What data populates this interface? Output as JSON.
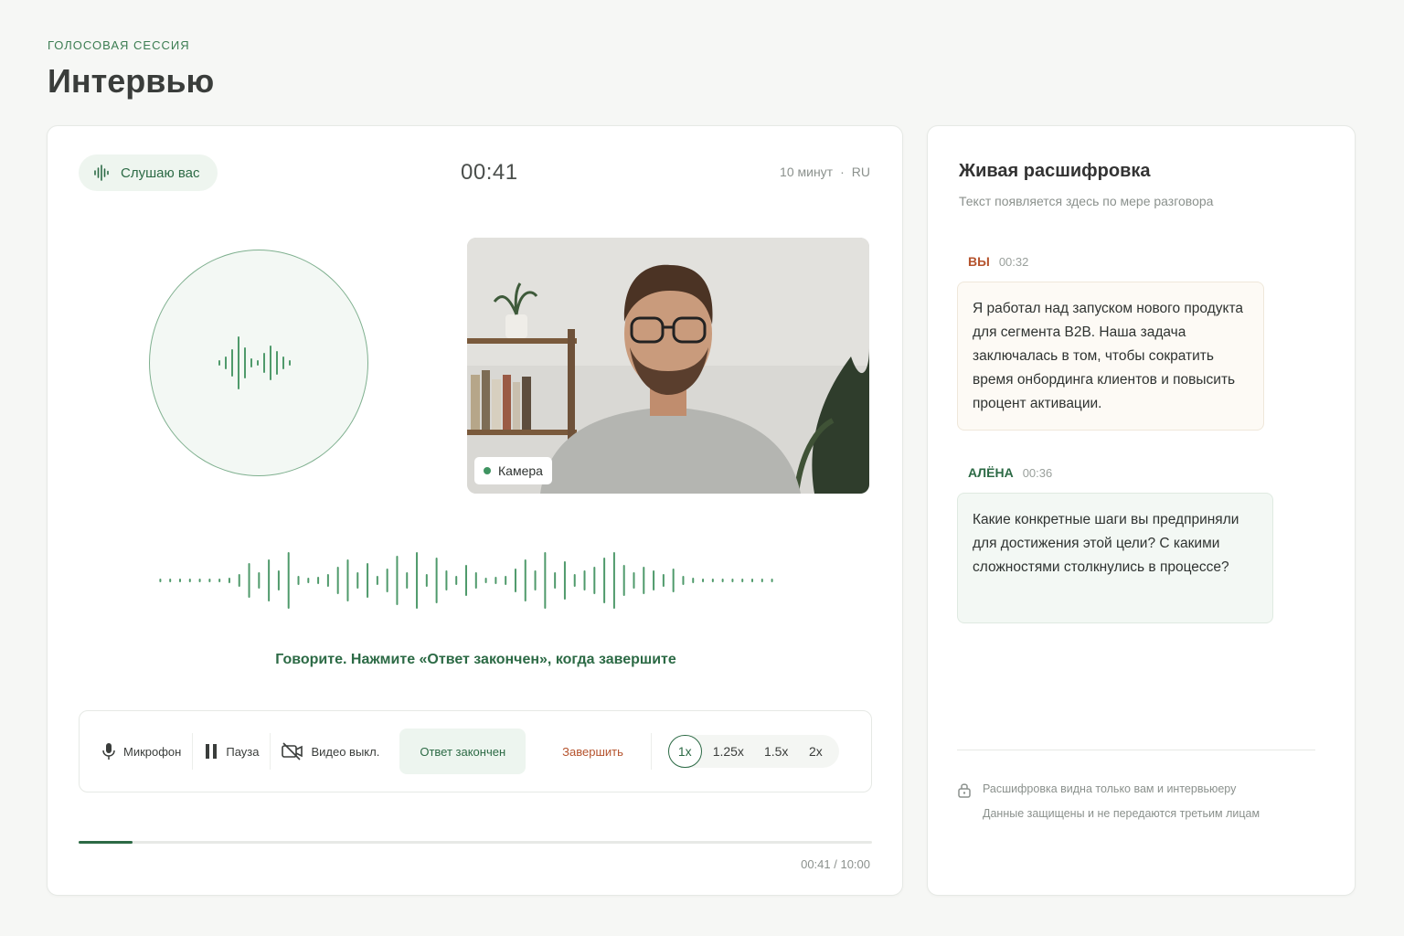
{
  "header": {
    "eyebrow": "ГОЛОСОВАЯ СЕССИЯ",
    "title": "Интервью"
  },
  "session": {
    "status_label": "Слушаю вас",
    "timer": "00:41",
    "duration": "10 минут",
    "separator": "·",
    "language": "RU",
    "camera_label": "Камера",
    "hint": "Говорите. Нажмите «Ответ закончен», когда завершите",
    "progress_fraction": 0.068,
    "time_readout": "00:41 / 10:00"
  },
  "controls": {
    "mic_label": "Микрофон",
    "pause_label": "Пауза",
    "video_label": "Видео выкл.",
    "answer_label": "Ответ закончен",
    "end_label": "Завершить",
    "speeds": [
      "1x",
      "1.25x",
      "1.5x",
      "2x"
    ],
    "active_speed": "1x"
  },
  "transcript": {
    "title": "Живая расшифровка",
    "subtitle": "Текст появляется здесь по мере разговора",
    "messages": [
      {
        "speaker": "ВЫ",
        "time": "00:32",
        "text": "Я работал над запуском нового продукта для сегмента B2B. Наша задача заключалась в том, чтобы сократить время онбординга клиентов и повысить процент активации."
      },
      {
        "speaker": "АЛЁНА",
        "time": "00:36",
        "text": "Какие конкретные шаги вы предприняли для достижения этой цели? С какими сложностями столкнулись в процессе?"
      }
    ],
    "privacy_line1": "Расшифровка видна только вам и интервьюеру",
    "privacy_line2": "Данные защищены и не передаются третьим лицам"
  },
  "colors": {
    "accent": "#2c6a45",
    "danger": "#b5532d"
  }
}
